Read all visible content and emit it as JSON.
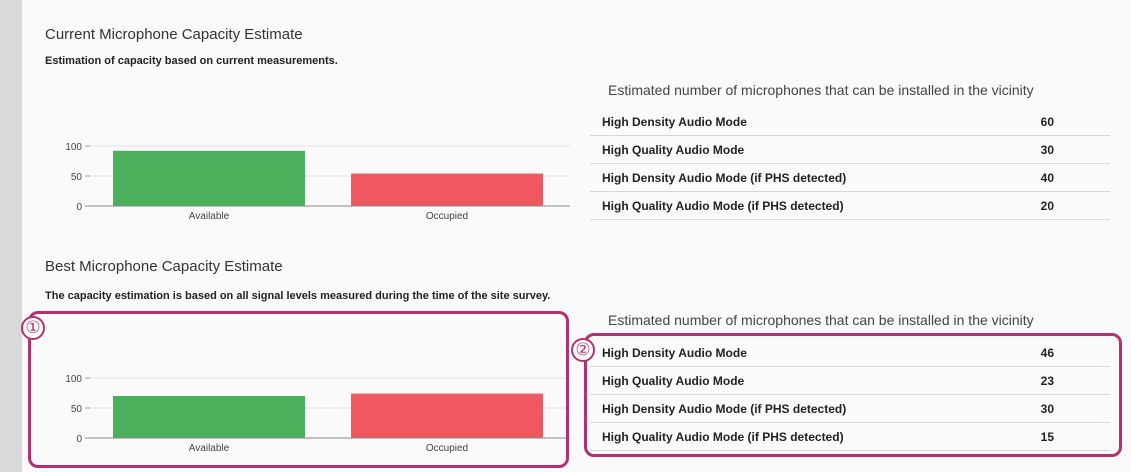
{
  "colors": {
    "available": "#4caf5c",
    "occupied": "#ef5860",
    "callout": "#b5306f"
  },
  "current": {
    "title": "Current Microphone Capacity Estimate",
    "description": "Estimation of capacity based on current measurements.",
    "table_heading": "Estimated number of microphones that can be installed in the vicinity",
    "rows": [
      {
        "label": "High Density Audio Mode",
        "value": "60"
      },
      {
        "label": "High Quality Audio Mode",
        "value": "30"
      },
      {
        "label": "High Density Audio Mode (if PHS detected)",
        "value": "40"
      },
      {
        "label": "High Quality Audio Mode (if PHS detected)",
        "value": "20"
      }
    ]
  },
  "best": {
    "title": "Best Microphone Capacity Estimate",
    "description": "The capacity estimation is based on all signal levels measured during the time of the site survey.",
    "table_heading": "Estimated number of microphones that can be installed in the vicinity",
    "rows": [
      {
        "label": "High Density Audio Mode",
        "value": "46"
      },
      {
        "label": "High Quality Audio Mode",
        "value": "23"
      },
      {
        "label": "High Density Audio Mode (if PHS detected)",
        "value": "30"
      },
      {
        "label": "High Quality Audio Mode (if PHS detected)",
        "value": "15"
      }
    ]
  },
  "callouts": {
    "chart": "①",
    "table": "②"
  },
  "chart_data": [
    {
      "type": "bar",
      "categories": [
        "Available",
        "Occupied"
      ],
      "values": [
        92,
        54
      ],
      "yticks": [
        "0",
        "50",
        "100"
      ],
      "ylim": [
        0,
        120
      ],
      "grid": true
    },
    {
      "type": "bar",
      "categories": [
        "Available",
        "Occupied"
      ],
      "values": [
        70,
        74
      ],
      "yticks": [
        "0",
        "50",
        "100"
      ],
      "ylim": [
        0,
        120
      ],
      "grid": true
    }
  ]
}
